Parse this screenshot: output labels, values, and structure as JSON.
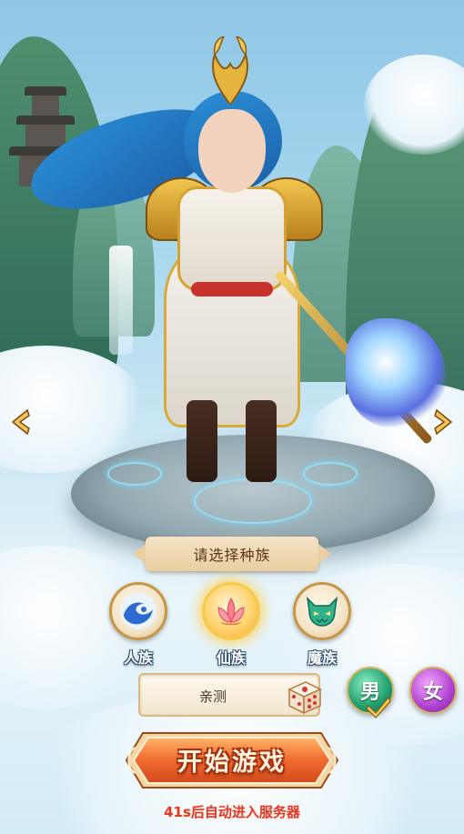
{
  "race_select": {
    "title": "请选择种族",
    "options": [
      {
        "label": "人族",
        "icon": "wave-icon",
        "selected": false
      },
      {
        "label": "仙族",
        "icon": "lotus-icon",
        "selected": true
      },
      {
        "label": "魔族",
        "icon": "demon-mask-icon",
        "selected": false
      }
    ]
  },
  "name_field": {
    "value": "亲测"
  },
  "gender": {
    "male_label": "男",
    "female_label": "女",
    "selected": "male"
  },
  "start_button": {
    "label": "开始游戏"
  },
  "countdown_text": "41s后自动进入服务器",
  "colors": {
    "start_button": "#f06a2f",
    "countdown": "#e2362a",
    "male": "#1f9d6c",
    "female": "#b043d2",
    "title_plate": "#e9cfa2"
  }
}
